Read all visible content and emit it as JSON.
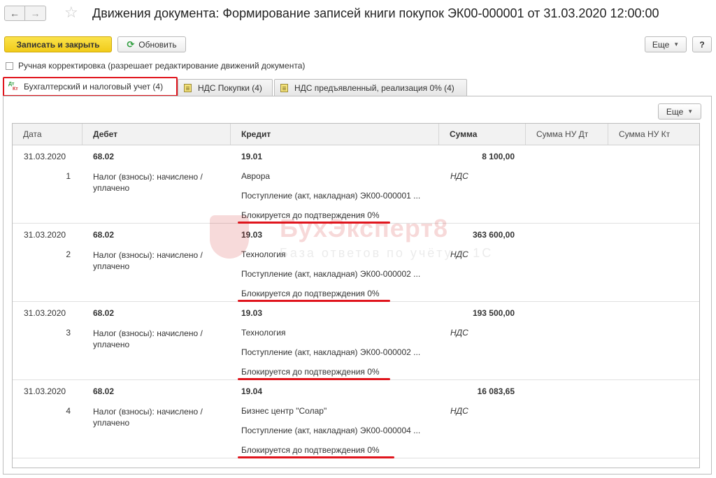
{
  "window": {
    "title": "Движения документа: Формирование записей книги покупок ЭК00-000001 от 31.03.2020 12:00:00",
    "back_icon": "arrow-left-icon",
    "forward_icon": "arrow-right-icon",
    "favorite_icon": "star-icon"
  },
  "toolbar": {
    "save_close_label": "Записать и закрыть",
    "refresh_label": "Обновить",
    "more_label": "Еще",
    "help_label": "?"
  },
  "manual_edit": {
    "label": "Ручная корректировка (разрешает редактирование движений документа)",
    "checked": false
  },
  "tabs": [
    {
      "label": "Бухгалтерский и налоговый учет (4)",
      "icon": "dt-kt-icon",
      "active": true
    },
    {
      "label": "НДС Покупки (4)",
      "icon": "register-icon",
      "active": false
    },
    {
      "label": "НДС предъявленный, реализация 0% (4)",
      "icon": "register-icon",
      "active": false
    }
  ],
  "tab_icon_text": {
    "dt": "Дт",
    "kt": "Кт"
  },
  "panel": {
    "more_label": "Еще"
  },
  "columns": {
    "date": "Дата",
    "debit": "Дебет",
    "credit": "Кредит",
    "amount": "Сумма",
    "nu_dt": "Сумма НУ Дт",
    "nu_kt": "Сумма НУ Кт"
  },
  "rows": [
    {
      "date": "31.03.2020",
      "num": "1",
      "debit_account": "68.02",
      "debit_sub": "Налог (взносы): начислено / уплачено",
      "credit_account": "19.01",
      "credit_sub1": "Аврора",
      "credit_sub2": "Поступление (акт, накладная) ЭК00-000001 ...",
      "credit_sub3": "Блокируется до подтверждения 0%",
      "amount": "8 100,00",
      "nds": "НДС"
    },
    {
      "date": "31.03.2020",
      "num": "2",
      "debit_account": "68.02",
      "debit_sub": "Налог (взносы): начислено / уплачено",
      "credit_account": "19.03",
      "credit_sub1": "Технология",
      "credit_sub2": "Поступление (акт, накладная) ЭК00-000002 ...",
      "credit_sub3": "Блокируется до подтверждения 0%",
      "amount": "363 600,00",
      "nds": "НДС"
    },
    {
      "date": "31.03.2020",
      "num": "3",
      "debit_account": "68.02",
      "debit_sub": "Налог (взносы): начислено / уплачено",
      "credit_account": "19.03",
      "credit_sub1": "Технология",
      "credit_sub2": "Поступление (акт, накладная) ЭК00-000002 ...",
      "credit_sub3": "Блокируется до подтверждения 0%",
      "amount": "193 500,00",
      "nds": "НДС"
    },
    {
      "date": "31.03.2020",
      "num": "4",
      "debit_account": "68.02",
      "debit_sub": "Налог (взносы): начислено / уплачено",
      "credit_account": "19.04",
      "credit_sub1": "Бизнес центр \"Солар\"",
      "credit_sub2": "Поступление (акт, накладная) ЭК00-000004 ...",
      "credit_sub3": "Блокируется до подтверждения 0%",
      "amount": "16 083,65",
      "nds": "НДС"
    }
  ],
  "watermark": {
    "name": "БухЭксперт8",
    "slogan": "База ответов по учёту в 1С"
  },
  "colors": {
    "highlight_red": "#e0151d",
    "primary_button": "#f1cb1a",
    "refresh_green": "#2d9c3c"
  }
}
